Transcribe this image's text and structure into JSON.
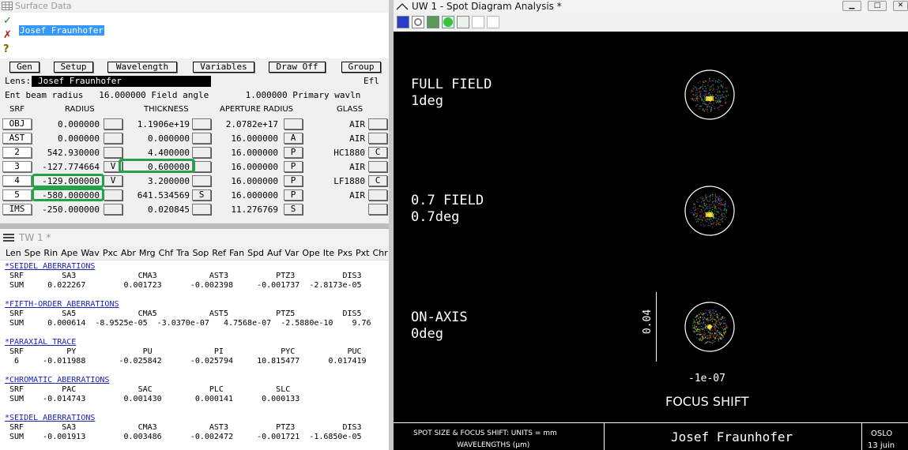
{
  "surface": {
    "title": "Surface Data",
    "command_value": "Josef Fraunhofer",
    "buttons": [
      "Gen",
      "Setup",
      "Wavelength",
      "Variables",
      "Draw Off",
      "Group"
    ],
    "lens_label": "Lens:",
    "lens_name": "Josef Fraunhofer",
    "efl_label": "Efl",
    "ent_row": "Ent beam radius   16.000000 Field angle       1.000000 Primary wavln",
    "headers": [
      "SRF",
      "RADIUS",
      "THICKNESS",
      "APERTURE RADIUS",
      "GLASS"
    ],
    "rows": [
      {
        "srf": "OBJ",
        "radius": "0.000000",
        "rad_flag": "",
        "thickness": "1.1906e+19",
        "thk_flag": "",
        "aperture": "2.0782e+17",
        "ap_flag": "",
        "glass": "AIR",
        "gl_flag": ""
      },
      {
        "srf": "AST",
        "radius": "0.000000",
        "rad_flag": "",
        "thickness": "0.000000",
        "thk_flag": "",
        "aperture": "16.000000",
        "ap_flag": "A",
        "glass": "AIR",
        "gl_flag": ""
      },
      {
        "srf": "2",
        "radius": "542.930000",
        "rad_flag": "",
        "thickness": "4.400000",
        "thk_flag": "",
        "aperture": "16.000000",
        "ap_flag": "P",
        "glass": "HC1880",
        "gl_flag": "C"
      },
      {
        "srf": "3",
        "radius": "-127.774664",
        "rad_flag": "V",
        "thickness": "0.600000",
        "thk_flag": "",
        "aperture": "16.000000",
        "ap_flag": "P",
        "glass": "AIR",
        "gl_flag": ""
      },
      {
        "srf": "4",
        "radius": "-129.000000",
        "rad_flag": "V",
        "thickness": "3.200000",
        "thk_flag": "",
        "aperture": "16.000000",
        "ap_flag": "P",
        "glass": "LF1880",
        "gl_flag": "C"
      },
      {
        "srf": "5",
        "radius": "-580.000000",
        "rad_flag": "",
        "thickness": "641.534569",
        "thk_flag": "S",
        "aperture": "16.000000",
        "ap_flag": "P",
        "glass": "AIR",
        "gl_flag": ""
      },
      {
        "srf": "IMS",
        "radius": "-250.000000",
        "rad_flag": "",
        "thickness": "0.020845",
        "thk_flag": "",
        "aperture": "11.276769",
        "ap_flag": "S",
        "glass": "",
        "gl_flag": ""
      }
    ]
  },
  "tw": {
    "title": "TW 1 *",
    "tools": [
      "Len",
      "Spe",
      "Rin",
      "Ape",
      "Wav",
      "Pxc",
      "Abr",
      "Mrg",
      "Chf",
      "Tra",
      "Sop",
      "Ref",
      "Fan",
      "Spd",
      "Auf",
      "Var",
      "Ope",
      "Ite",
      "Pxs",
      "Pxt",
      "Chr"
    ],
    "sections": [
      {
        "title": "*SEIDEL ABERRATIONS",
        "header": " SRF        SA3             CMA3           AST3          PTZ3          DIS3",
        "row": " SUM     0.022267        0.001723      -0.002398     -0.001737  -2.8173e-05"
      },
      {
        "title": "*FIFTH-ORDER ABERRATIONS",
        "header": " SRF        SA5             CMA5           AST5          PTZ5          DIS5",
        "row": " SUM     0.000614  -8.9525e-05  -3.0370e-07   4.7568e-07  -2.5880e-10    9.76"
      },
      {
        "title": "*PARAXIAL TRACE",
        "header": " SRF         PY              PU             PI            PYC           PUC",
        "row": "  6     -0.011988       -0.025842      -0.025794     10.815477      0.017419     -0."
      },
      {
        "title": "*CHROMATIC ABERRATIONS",
        "header": " SRF        PAC             SAC            PLC           SLC",
        "row": " SUM    -0.014743        0.001430       0.000141      0.000133"
      },
      {
        "title": "*SEIDEL ABERRATIONS",
        "header": " SRF        SA3             CMA3           AST3          PTZ3          DIS3",
        "row": " SUM    -0.001913        0.003486      -0.002472     -0.001721  -1.6850e-05"
      }
    ]
  },
  "spot": {
    "title": "UW 1 - Spot Diagram Analysis *",
    "fields": [
      {
        "name": "FULL FIELD",
        "angle": "1deg"
      },
      {
        "name": "0.7 FIELD",
        "angle": "0.7deg"
      },
      {
        "name": "ON-AXIS",
        "angle": "0deg"
      }
    ],
    "scale_label": "0.04",
    "focus_value": "-1e-07",
    "focus_label": "FOCUS SHIFT",
    "footer_units": "SPOT SIZE & FOCUS SHIFT: UNITS = mm",
    "footer_wave": "WAVELENGTHS (μm)",
    "footer_lens": "Josef Fraunhofer",
    "footer_app": "OSLO",
    "footer_date": "13 juin"
  }
}
